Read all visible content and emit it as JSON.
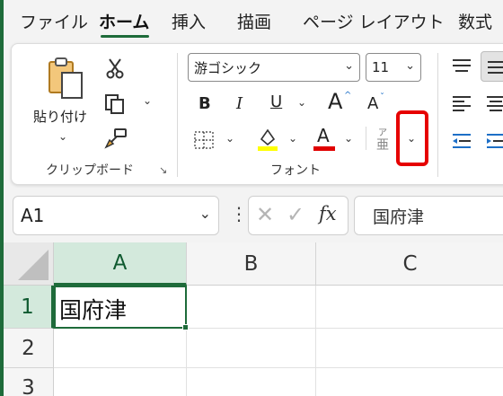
{
  "tabs": [
    "ファイル",
    "ホーム",
    "挿入",
    "描画",
    "ページ レイアウト",
    "数式"
  ],
  "active_tab": "ホーム",
  "clipboard": {
    "paste_label": "貼り付け",
    "group_label": "クリップボード"
  },
  "font": {
    "font_name": "游ゴシック",
    "font_size": "11",
    "bold": "B",
    "italic": "I",
    "underline": "U",
    "grow": "A",
    "shrink": "A",
    "font_color": "A",
    "phonetic_top": "ア",
    "phonetic_bottom": "亜",
    "group_label": "フォント"
  },
  "formula_bar": {
    "name_box": "A1",
    "fx": "fx",
    "content": "国府津"
  },
  "grid": {
    "columns": [
      "A",
      "B",
      "C"
    ],
    "rows": [
      "1",
      "2",
      "3"
    ],
    "cells": {
      "A1": "国府津"
    }
  },
  "colors": {
    "accent": "#1e6b3a",
    "highlight_yellow": "#ffff00",
    "font_red": "#e00000",
    "callout_red": "#e60000"
  }
}
